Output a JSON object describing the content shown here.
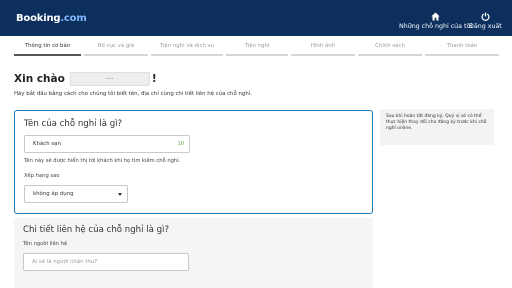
{
  "header": {
    "logo_main": "Booking",
    "logo_suffix": ".com",
    "properties_label": "Những chỗ nghỉ của tôi",
    "logout_label": "Đăng xuất",
    "properties_icon": "home-icon",
    "logout_icon": "power-icon"
  },
  "stepper": {
    "steps": [
      {
        "label": "Thông tin cơ bản"
      },
      {
        "label": "Bố cục và giá"
      },
      {
        "label": "Tiện nghi và dịch vụ"
      },
      {
        "label": "Tiện nghi"
      },
      {
        "label": "Hình ảnh"
      },
      {
        "label": "Chính sách"
      },
      {
        "label": "Thanh toán"
      }
    ],
    "active_index": 0
  },
  "main": {
    "greeting": "Xin chào",
    "user_name": "....",
    "greeting_end": "!",
    "intro": "Hãy bắt đầu bằng cách cho chúng tôi biết tên, địa chỉ cùng chi tiết liên hệ của chỗ nghỉ."
  },
  "property_card": {
    "title": "Tên của chỗ nghỉ là gì?",
    "name_value": "Khách sạn",
    "char_counter": "10",
    "hint": "Tên này sẽ được hiển thị tới khách khi họ tìm kiếm chỗ nghỉ.",
    "star_label": "Xếp hạng sao",
    "star_value": "không áp dụng"
  },
  "contact_card": {
    "title": "Chi tiết liên hệ của chỗ nghỉ là gì?",
    "contact_label": "Tên người liên hệ",
    "contact_placeholder": "Ai sẽ là người nhận thư?"
  },
  "sidebar": {
    "note": "Sau khi hoàn tất đăng ký, Quý vị sẽ có thể thực hiện thay đổi cho đăng ký trước khi chỗ nghỉ online."
  },
  "colors": {
    "header_bg": "#0c2f5e",
    "accent": "#1f7bb8",
    "counter": "#5aa33c"
  }
}
